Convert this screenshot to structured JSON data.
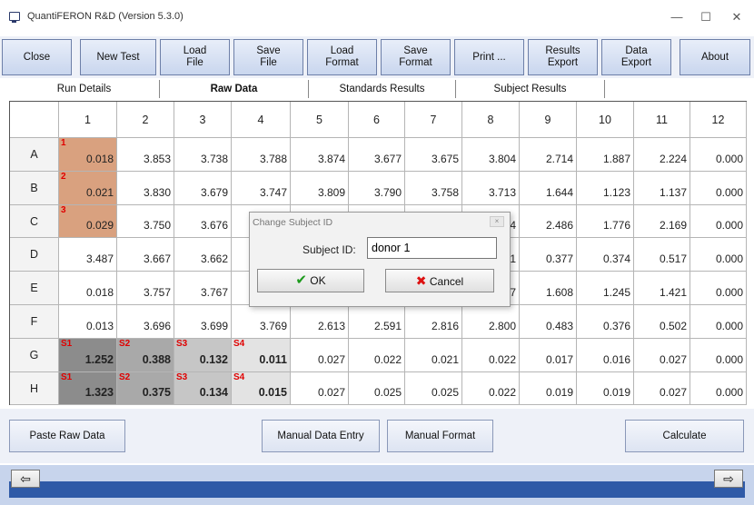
{
  "window": {
    "title": "QuantiFERON R&D (Version 5.3.0)",
    "minimize": "—",
    "maximize": "☐",
    "close": "✕"
  },
  "toolbar": {
    "buttons": [
      {
        "label": "Close"
      },
      {
        "label": "New Test"
      },
      {
        "label": "Load\nFile"
      },
      {
        "label": "Save\nFile"
      },
      {
        "label": "Load\nFormat"
      },
      {
        "label": "Save\nFormat"
      },
      {
        "label": "Print ..."
      },
      {
        "label": "Results\nExport"
      },
      {
        "label": "Data\nExport"
      },
      {
        "label": "About"
      }
    ]
  },
  "tabs": [
    {
      "label": "Run Details"
    },
    {
      "label": "Raw Data"
    },
    {
      "label": "Standards Results"
    },
    {
      "label": "Subject Results"
    }
  ],
  "grid": {
    "columns": [
      "1",
      "2",
      "3",
      "4",
      "5",
      "6",
      "7",
      "8",
      "9",
      "10",
      "11",
      "12"
    ],
    "rows": [
      {
        "label": "A",
        "cells": [
          "0.018",
          "3.853",
          "3.738",
          "3.788",
          "3.874",
          "3.677",
          "3.675",
          "3.804",
          "2.714",
          "1.887",
          "2.224",
          "0.000"
        ]
      },
      {
        "label": "B",
        "cells": [
          "0.021",
          "3.830",
          "3.679",
          "3.747",
          "3.809",
          "3.790",
          "3.758",
          "3.713",
          "1.644",
          "1.123",
          "1.137",
          "0.000"
        ]
      },
      {
        "label": "C",
        "cells": [
          "0.029",
          "3.750",
          "3.676",
          "",
          "",
          "",
          "",
          "4",
          "2.486",
          "1.776",
          "2.169",
          "0.000"
        ]
      },
      {
        "label": "D",
        "cells": [
          "3.487",
          "3.667",
          "3.662",
          "",
          "",
          "",
          "",
          "1",
          "0.377",
          "0.374",
          "0.517",
          "0.000"
        ]
      },
      {
        "label": "E",
        "cells": [
          "0.018",
          "3.757",
          "3.767",
          "",
          "",
          "",
          "",
          "7",
          "1.608",
          "1.245",
          "1.421",
          "0.000"
        ]
      },
      {
        "label": "F",
        "cells": [
          "0.013",
          "3.696",
          "3.699",
          "3.769",
          "2.613",
          "2.591",
          "2.816",
          "2.800",
          "0.483",
          "0.376",
          "0.502",
          "0.000"
        ]
      },
      {
        "label": "G",
        "cells": [
          "1.252",
          "0.388",
          "0.132",
          "0.011",
          "0.027",
          "0.022",
          "0.021",
          "0.022",
          "0.017",
          "0.016",
          "0.027",
          "0.000"
        ]
      },
      {
        "label": "H",
        "cells": [
          "1.323",
          "0.375",
          "0.134",
          "0.015",
          "0.027",
          "0.025",
          "0.025",
          "0.022",
          "0.019",
          "0.019",
          "0.027",
          "0.000"
        ]
      }
    ],
    "markers": {
      "A1": "1",
      "B1": "2",
      "C1": "3",
      "G1": "S1",
      "G2": "S2",
      "G3": "S3",
      "G4": "S4",
      "H1": "S1",
      "H2": "S2",
      "H3": "S3",
      "H4": "S4"
    },
    "colors": {
      "blank_fill": "#d9a17f",
      "std1_fill": "#8c8c8c",
      "std2_fill": "#a9a9a9",
      "std3_fill": "#c6c6c6",
      "std4_fill": "#e3e3e3",
      "marker_color": "#e00000"
    }
  },
  "bottom": {
    "paste": "Paste Raw Data",
    "manual_entry": "Manual Data Entry",
    "manual_format": "Manual Format",
    "calculate": "Calculate",
    "prev": "⇦",
    "next": "⇨"
  },
  "dialog": {
    "title": "Change Subject ID",
    "close": "×",
    "label": "Subject ID:",
    "value": "donor 1",
    "ok": "OK",
    "cancel": "Cancel"
  }
}
